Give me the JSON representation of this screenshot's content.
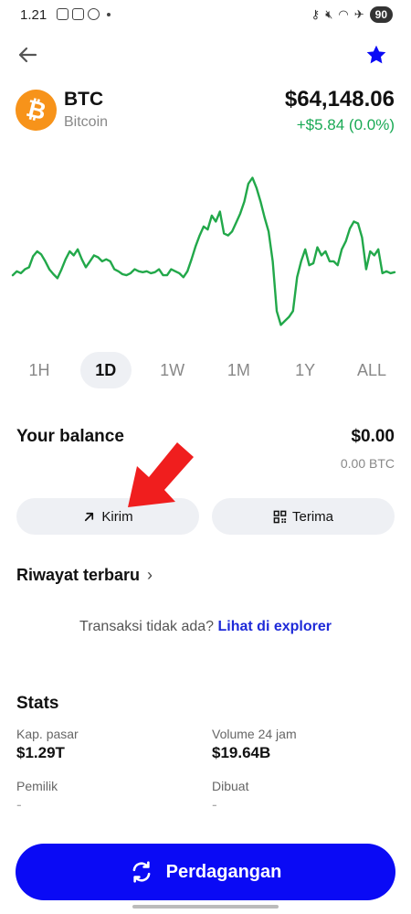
{
  "status_bar": {
    "time": "1.21",
    "battery": "90"
  },
  "coin": {
    "symbol": "BTC",
    "name": "Bitcoin",
    "logo_glyph": "₿",
    "price": "$64,148.06",
    "change": "+$5.84 (0.0%)"
  },
  "colors": {
    "accent": "#0a0af5",
    "positive": "#1aaa55",
    "chart_line": "#22a84a",
    "btc_orange": "#f7931a",
    "arrow_red": "#f01e1e"
  },
  "chart_data": {
    "type": "line",
    "title": "",
    "xlabel": "",
    "ylabel": "",
    "y": [
      6,
      10,
      8,
      12,
      14,
      25,
      30,
      27,
      20,
      12,
      7,
      3,
      12,
      22,
      30,
      26,
      32,
      22,
      14,
      20,
      26,
      24,
      20,
      22,
      20,
      12,
      10,
      7,
      6,
      8,
      12,
      10,
      9,
      10,
      8,
      9,
      12,
      6,
      6,
      12,
      10,
      8,
      4,
      10,
      22,
      35,
      46,
      55,
      52,
      66,
      60,
      70,
      48,
      46,
      50,
      59,
      68,
      80,
      98,
      104,
      94,
      80,
      64,
      50,
      20,
      -30,
      -44,
      -40,
      -36,
      -30,
      4,
      20,
      32,
      16,
      18,
      34,
      26,
      30,
      20,
      20,
      16,
      32,
      40,
      53,
      60,
      58,
      44,
      12,
      30,
      26,
      32,
      8,
      10,
      8,
      9
    ],
    "ylim": [
      -50,
      110
    ],
    "timeframes": [
      "1H",
      "1D",
      "1W",
      "1M",
      "1Y",
      "ALL"
    ],
    "selected_timeframe": "1D"
  },
  "balance": {
    "label": "Your balance",
    "usd": "$0.00",
    "btc": "0.00 BTC"
  },
  "actions": {
    "send_label": "Kirim",
    "receive_label": "Terima"
  },
  "history": {
    "title": "Riwayat terbaru",
    "empty_text": "Transaksi tidak ada?",
    "explorer_link": "Lihat di explorer"
  },
  "stats": {
    "title": "Stats",
    "items": [
      {
        "label": "Kap. pasar",
        "value": "$1.29T"
      },
      {
        "label": "Volume 24 jam",
        "value": "$19.64B"
      },
      {
        "label": "Pemilik",
        "value": "-"
      },
      {
        "label": "Dibuat",
        "value": "-"
      }
    ]
  },
  "trade_button": {
    "label": "Perdagangan"
  }
}
